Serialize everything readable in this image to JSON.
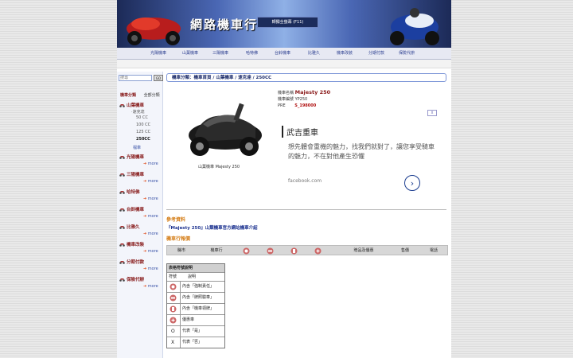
{
  "banner": {
    "site_title": "網路機車行",
    "fullscreen_label": "轉獨全螢幕 (F11)"
  },
  "nav": {
    "items": [
      "光陽機車",
      "山葉機車",
      "三陽機車",
      "哈特佛",
      "台鈴機車",
      "比雅久",
      "機車改裝",
      "分期付款",
      "保險代辦"
    ]
  },
  "sidebar": {
    "search_placeholder": "搜尋",
    "search_button": "GO",
    "tabs": {
      "category": "機車分類",
      "all": "全部分類"
    },
    "categories": [
      {
        "label": "山葉機車",
        "subs": [
          "·速克達",
          "50 CC",
          "100 CC",
          "125 CC",
          "250CC",
          "檔車"
        ]
      },
      {
        "label": "光陽機車",
        "more": "more"
      },
      {
        "label": "三陽機車",
        "more": "more"
      },
      {
        "label": "哈特佛",
        "more": "more"
      },
      {
        "label": "台鈴機車",
        "more": "more"
      },
      {
        "label": "比雅久",
        "more": "more"
      },
      {
        "label": "機車改裝",
        "more": "more"
      },
      {
        "label": "分期付款",
        "more": "more"
      },
      {
        "label": "保險代辦",
        "more": "more"
      }
    ]
  },
  "main": {
    "breadcrumb": "機車分類：機車首頁 / 山葉機車 / 速克達 / 250CC",
    "product": {
      "name_label": "機車名稱",
      "name": "Majesty 250",
      "model_label": "機車編號",
      "model": "YP250",
      "price_label": "PRE",
      "price": "S_198000",
      "caption": "山葉機車 Majesty 250"
    },
    "ad": {
      "close": "X",
      "title": "武吉重車",
      "text": "想先體會重機的魅力，找我們就對了，讓您享受騎車的魅力，不在對他產生恐懼",
      "link": "facebook.com",
      "arrow": "›"
    },
    "reference": {
      "title": "參考資料",
      "link": "『Majesty 250』山葉機車官方網站機車介紹"
    },
    "dealer": {
      "title": "機車行報價",
      "columns": [
        "縣市",
        "機車行",
        "贈品及優惠",
        "售價",
        "電話"
      ]
    },
    "legend": {
      "title": "表格符號說明",
      "col_symbol": "符號",
      "col_desc": "說明",
      "rows": [
        {
          "icon": "helmet-icon",
          "desc": "內含「強制責任」"
        },
        {
          "icon": "wrench-icon",
          "desc": "內含「牌照驗車」"
        },
        {
          "icon": "tag-icon",
          "desc": "內含「機車領牌」"
        },
        {
          "icon": "gift-icon",
          "desc": "優惠車"
        },
        {
          "symbol": "O",
          "desc": "代表「是」"
        },
        {
          "symbol": "X",
          "desc": "代表「否」"
        }
      ]
    }
  }
}
